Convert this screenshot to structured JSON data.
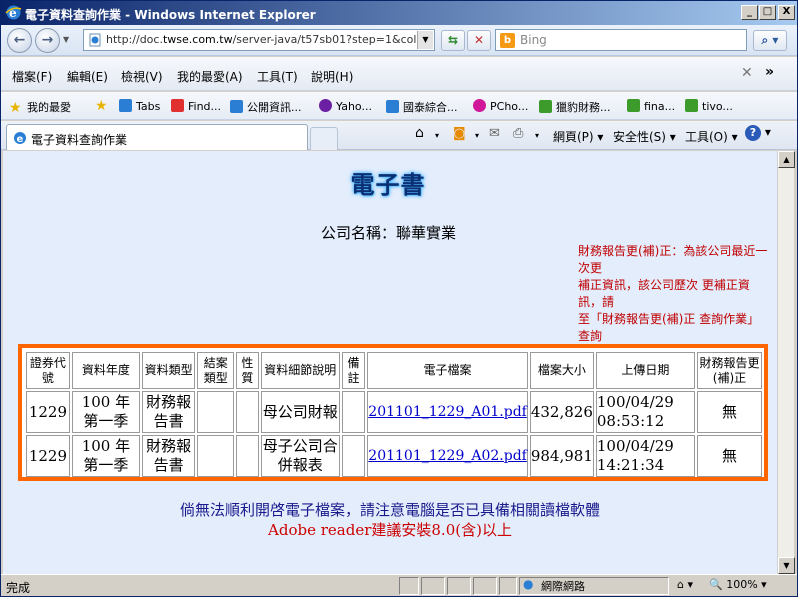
{
  "window": {
    "title": "電子資料查詢作業 - Windows Internet Explorer",
    "min_glyph": "_",
    "max_glyph": "□",
    "close_glyph": "X"
  },
  "address_bar": {
    "url_prefix": "http://doc.",
    "url_domain": "twse.com.tw",
    "url_suffix": "/server-java/t57sb01?step=1&colorchg=1&c",
    "search_placeholder": "Bing"
  },
  "menu": {
    "items": [
      "檔案(F)",
      "編輯(E)",
      "檢視(V)",
      "我的最愛(A)",
      "工具(T)",
      "說明(H)"
    ]
  },
  "favorites": {
    "label": "我的最愛",
    "items": [
      "Tabs",
      "Find...",
      "公開資訊...",
      "Yaho...",
      "國泰綜合...",
      "PCho...",
      "獵豹財務...",
      "fina...",
      "tivo..."
    ]
  },
  "tabbar": {
    "tab_label": "電子資料查詢作業",
    "page_menu": "網頁(P)",
    "safety_menu": "安全性(S)",
    "tools_menu": "工具(O)"
  },
  "page": {
    "ebook_title": "電子書",
    "company": "公司名稱：聯華實業",
    "notice": [
      "財務報告更(補)正：為該公司最近一次更",
      "補正資訊，該公司歷次 更補正資訊，請",
      "至「財務報告更(補)正 查詢作業」查詢"
    ],
    "table": {
      "headers": [
        "證券代號",
        "資料年度",
        "資料類型",
        "結案類型",
        "性質",
        "資料細節說明",
        "備註",
        "電子檔案",
        "檔案大小",
        "上傳日期",
        "財務報告更(補)正"
      ],
      "rows": [
        [
          "1229",
          "100 年 第一季",
          "財務報告書",
          "",
          "",
          "母公司財報",
          "",
          "201101_1229_A01.pdf",
          "432,826",
          "100/04/29 08:53:12",
          "無"
        ],
        [
          "1229",
          "100 年 第一季",
          "財務報告書",
          "",
          "",
          "母子公司合併報表",
          "",
          "201101_1229_A02.pdf",
          "984,981",
          "100/04/29 14:21:34",
          "無"
        ]
      ]
    },
    "footer_line1": "倘無法順利開啓電子檔案，請注意電腦是否已具備相關讀檔軟體",
    "footer_line2": "Adobe reader建議安裝8.0(含)以上"
  },
  "status": {
    "text": "完成",
    "zone": "網際網路",
    "zoom": "100%"
  }
}
